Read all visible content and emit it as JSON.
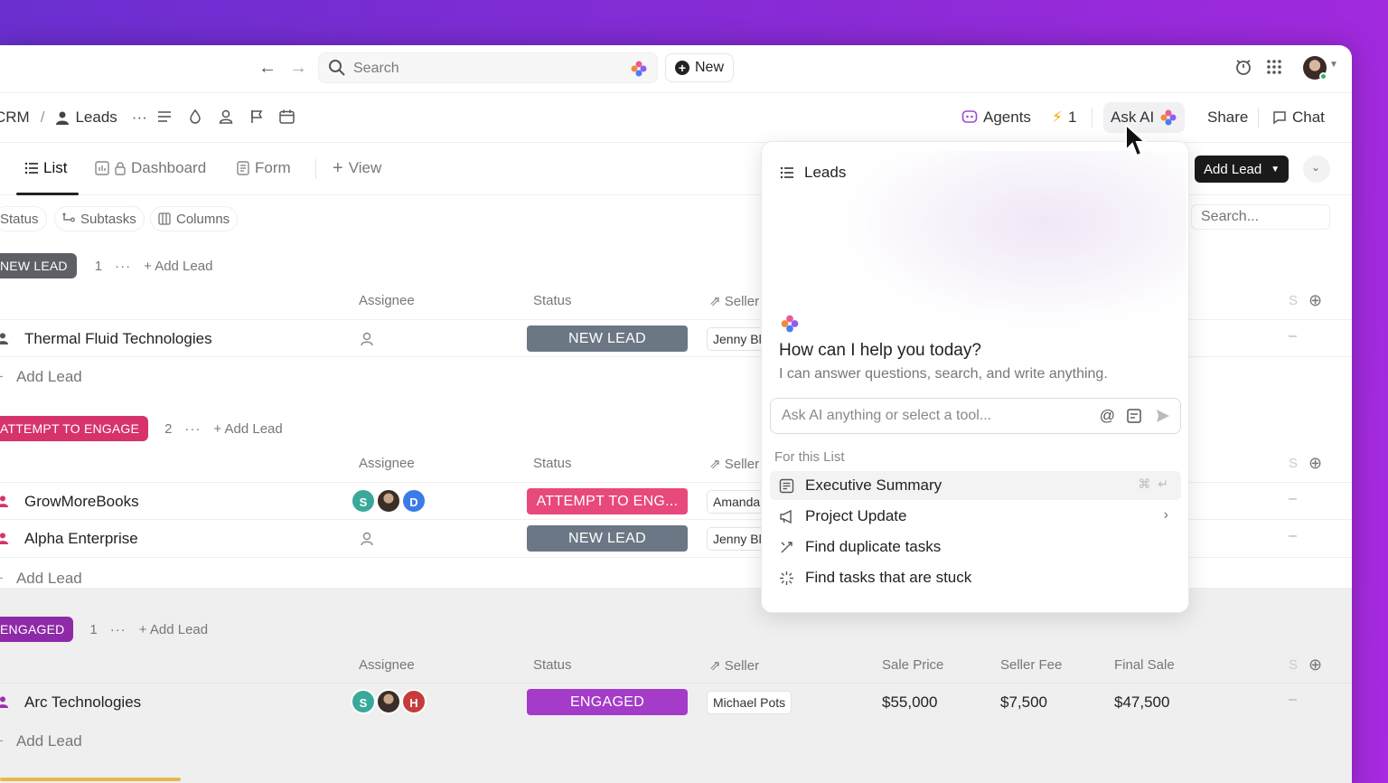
{
  "topbar": {
    "search_placeholder": "Search",
    "new_label": "New"
  },
  "header": {
    "crumb_space": "CRM",
    "crumb_sep": "/",
    "crumb_list": "Leads",
    "more": "···",
    "agents_label": "Agents",
    "automation_count": "1",
    "ask_ai_label": "Ask AI",
    "share_label": "Share",
    "chat_label": "Chat"
  },
  "views": {
    "tabs": [
      {
        "label": "List"
      },
      {
        "label": "Dashboard"
      },
      {
        "label": "Form"
      },
      {
        "label": "View"
      }
    ],
    "add_lead_label": "Add Lead"
  },
  "filters": {
    "chips": [
      "Status",
      "Subtasks",
      "Columns"
    ],
    "search_placeholder": "Search..."
  },
  "columns": {
    "assignee": "Assignee",
    "status": "Status",
    "seller": "Seller",
    "sale_price": "Sale Price",
    "seller_fee": "Seller Fee",
    "final_sale": "Final Sale",
    "truncated": "S"
  },
  "groups": [
    {
      "badge": "NEW LEAD",
      "color": "#6e6e73",
      "count": "1",
      "add_label": "Add Lead",
      "rows": [
        {
          "name": "Thermal Fluid Technologies",
          "status": "NEW LEAD",
          "status_color": "#6c7785",
          "seller": "Jenny Bl",
          "dash": "–"
        }
      ],
      "add_row": "Add Lead"
    },
    {
      "badge": "ATTEMPT TO ENGAGE",
      "color": "#d6336c",
      "count": "2",
      "add_label": "Add Lead",
      "rows": [
        {
          "name": "GrowMoreBooks",
          "status": "ATTEMPT TO ENG...",
          "status_color": "#e8497b",
          "seller": "Amanda",
          "dash": "–",
          "avatars": [
            "S",
            "",
            "D"
          ]
        },
        {
          "name": "Alpha Enterprise",
          "status": "NEW LEAD",
          "status_color": "#6c7785",
          "seller": "Jenny Bl",
          "dash": "–"
        }
      ],
      "add_row": "Add Lead"
    },
    {
      "badge": "ENGAGED",
      "color": "#8e2aa8",
      "count": "1",
      "add_label": "Add Lead",
      "rows": [
        {
          "name": "Arc Technologies",
          "status": "ENGAGED",
          "status_color": "#a43bc9",
          "seller": "Michael Pots",
          "sale_price": "$55,000",
          "seller_fee": "$7,500",
          "final_sale": "$47,500",
          "dash": "–",
          "avatars": [
            "S",
            "",
            "H"
          ]
        }
      ],
      "add_row": "Add Lead"
    }
  ],
  "ai_panel": {
    "title": "Leads",
    "greeting": "How can I help you today?",
    "subtitle": "I can answer questions, search, and write anything.",
    "input_placeholder": "Ask AI anything or select a tool...",
    "section_label": "For this List",
    "tools": [
      {
        "label": "Executive Summary",
        "icon": "summary-icon"
      },
      {
        "label": "Project Update",
        "icon": "megaphone-icon"
      },
      {
        "label": "Find duplicate tasks",
        "icon": "duplicate-icon"
      },
      {
        "label": "Find tasks that are stuck",
        "icon": "stuck-icon"
      }
    ]
  }
}
